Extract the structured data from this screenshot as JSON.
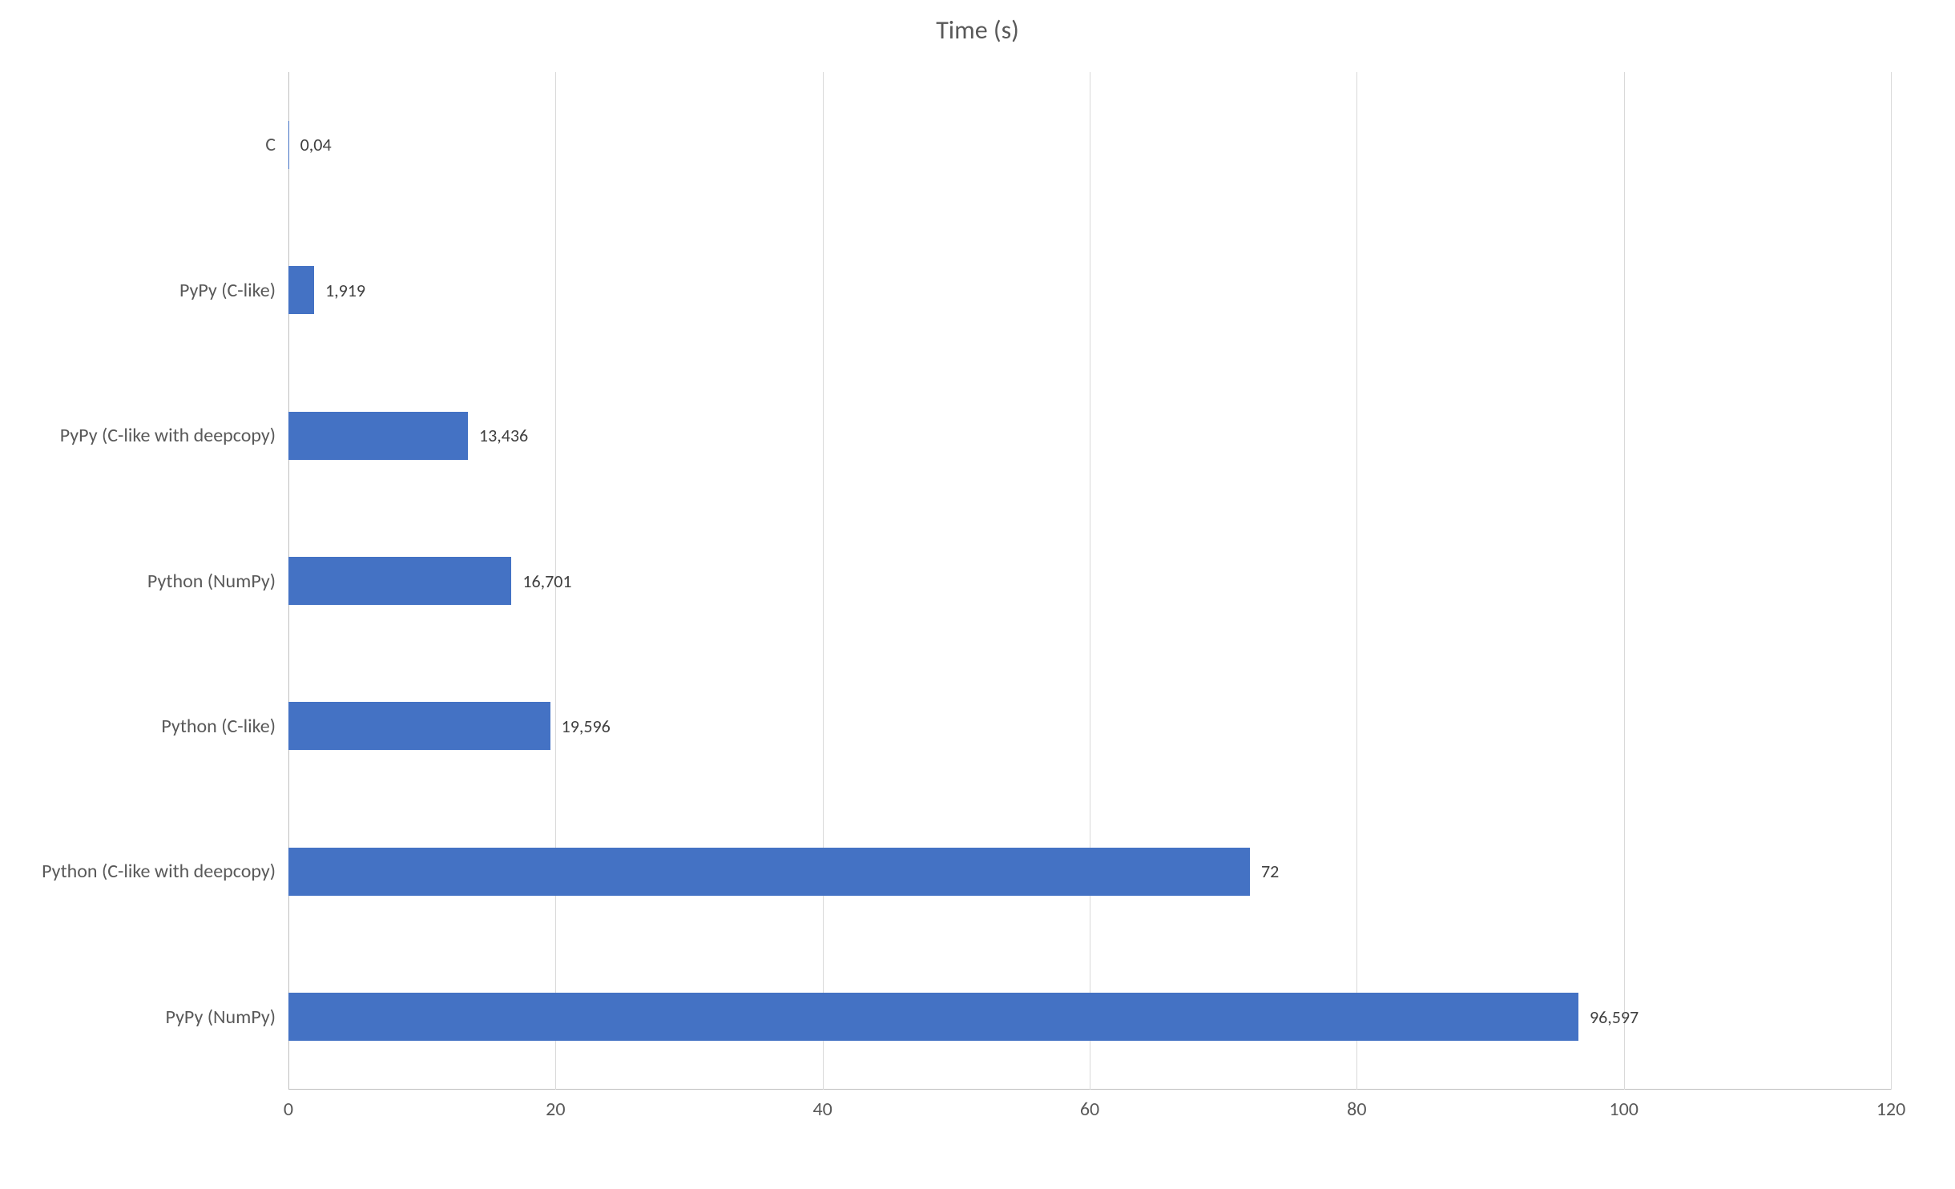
{
  "chart_data": {
    "type": "bar",
    "orientation": "horizontal",
    "title": "Time (s)",
    "categories": [
      "C",
      "PyPy (C-like)",
      "PyPy (C-like with deepcopy)",
      "Python (NumPy)",
      "Python (C-like)",
      "Python (C-like with deepcopy)",
      "PyPy (NumPy)"
    ],
    "values": [
      0.04,
      1.919,
      13.436,
      16.701,
      19.596,
      72,
      96.597
    ],
    "value_labels": [
      "0,04",
      "1,919",
      "13,436",
      "16,701",
      "19,596",
      "72",
      "96,597"
    ],
    "xlabel": "",
    "ylabel": "",
    "xlim": [
      0,
      120
    ],
    "xticks": [
      0,
      20,
      40,
      60,
      80,
      100,
      120
    ],
    "bar_color": "#4472c4",
    "grid": true
  }
}
